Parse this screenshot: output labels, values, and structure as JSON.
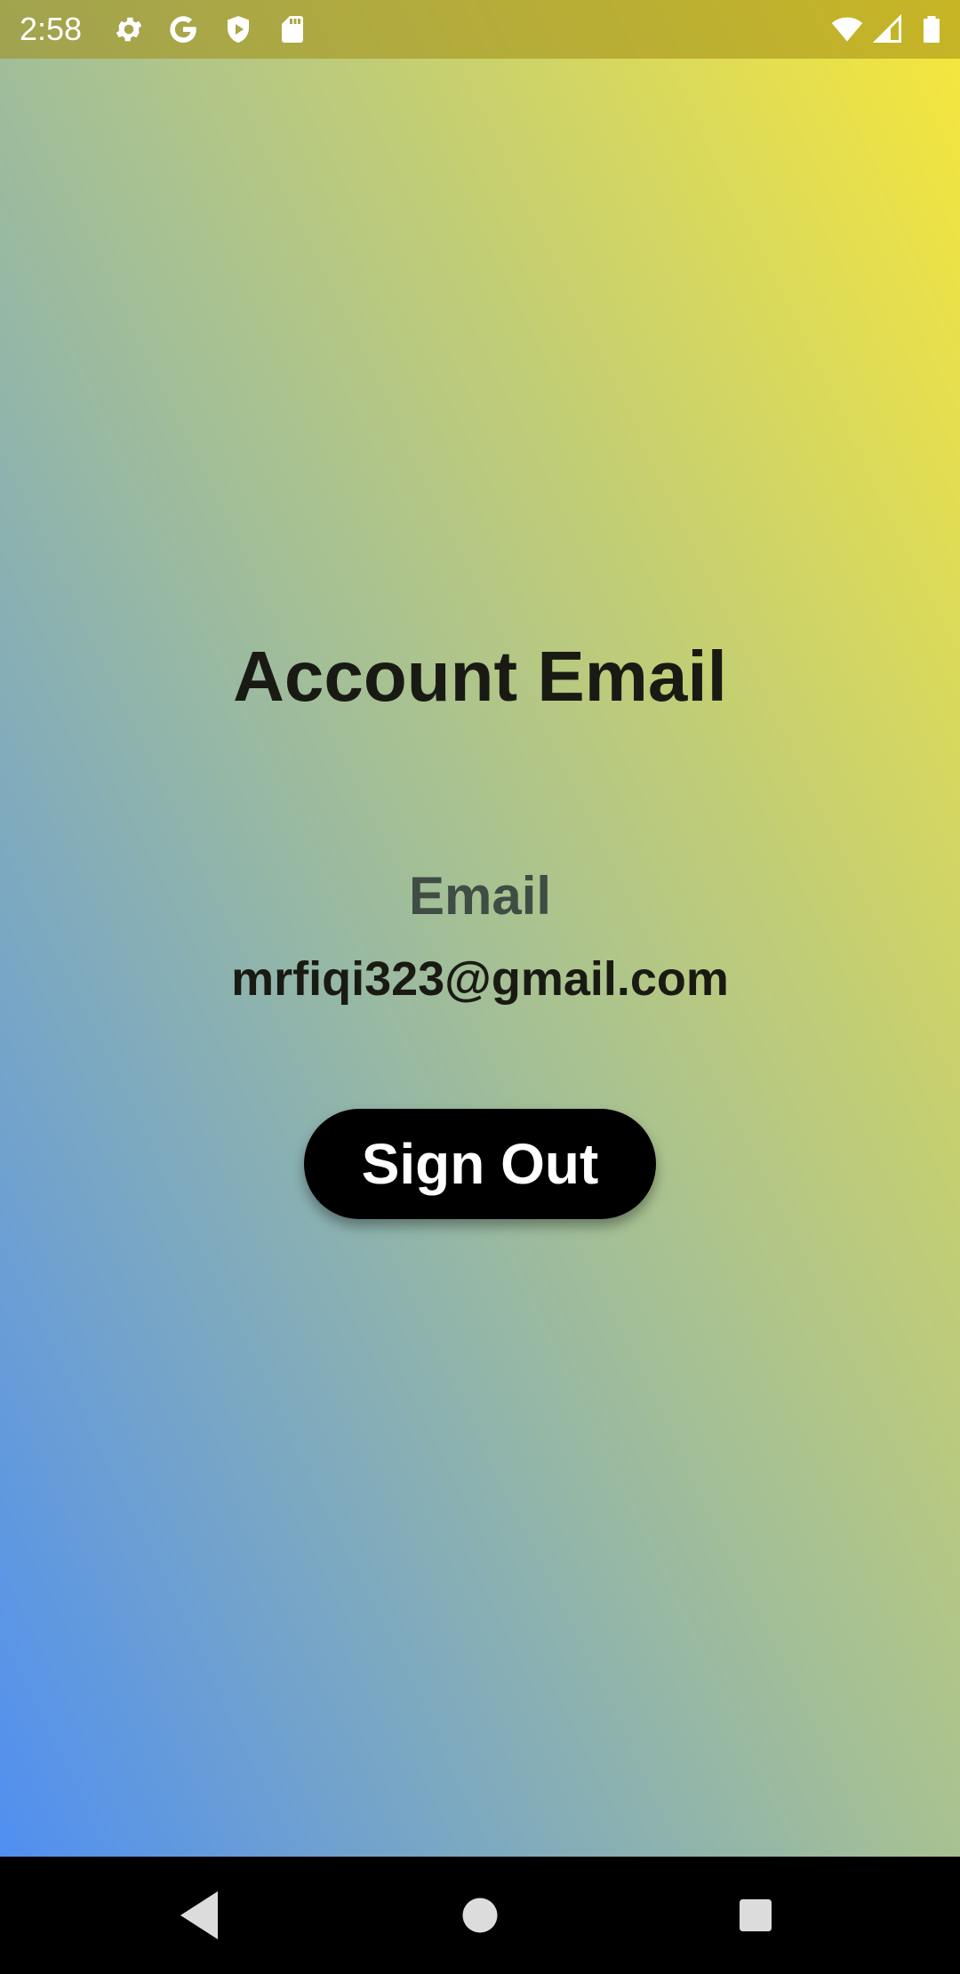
{
  "status_bar": {
    "time": "2:58",
    "left_icons": [
      "gear-icon",
      "google-icon",
      "shield-play-icon",
      "sd-card-icon"
    ],
    "right_icons": [
      "wifi-icon",
      "signal-icon",
      "battery-icon"
    ]
  },
  "main": {
    "title": "Account Email",
    "email_label": "Email",
    "email_value": "mrfiqi323@gmail.com",
    "sign_out_label": "Sign Out"
  },
  "nav_bar": {
    "buttons": [
      "back-icon",
      "home-icon",
      "recents-icon"
    ]
  },
  "colors": {
    "gradient_bottom_left": "#4b8cf7",
    "gradient_top_right": "#f7e73b",
    "button_bg": "#000000",
    "button_text": "#ffffff"
  }
}
